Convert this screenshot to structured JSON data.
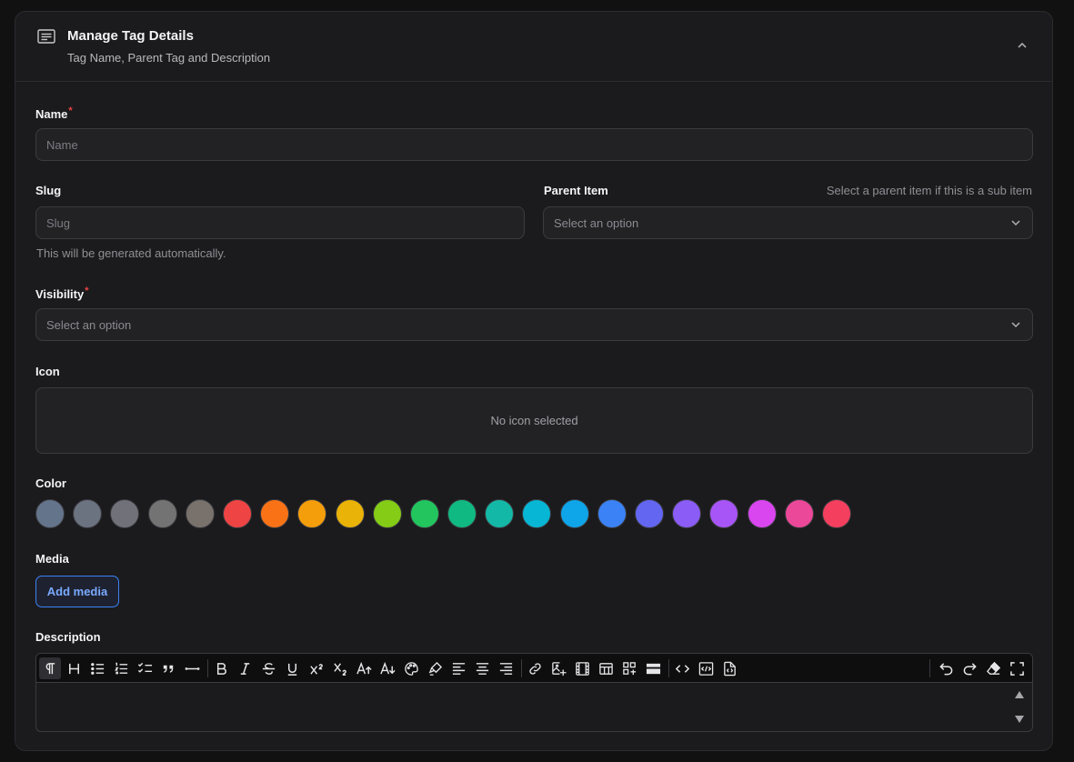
{
  "header": {
    "title": "Manage Tag Details",
    "subtitle": "Tag Name, Parent Tag and Description"
  },
  "form": {
    "name": {
      "label": "Name",
      "required_mark": "*",
      "placeholder": "Name"
    },
    "slug": {
      "label": "Slug",
      "placeholder": "Slug",
      "helper": "This will be generated automatically."
    },
    "parent": {
      "label": "Parent Item",
      "hint": "Select a parent item if this is a sub item",
      "value": "Select an option"
    },
    "visibility": {
      "label": "Visibility",
      "required_mark": "*",
      "value": "Select an option"
    },
    "icon": {
      "label": "Icon",
      "empty_text": "No icon selected"
    },
    "color": {
      "label": "Color",
      "swatches": [
        "#64748b",
        "#6b7280",
        "#71717a",
        "#737373",
        "#78716c",
        "#ef4444",
        "#f97316",
        "#f59e0b",
        "#eab308",
        "#84cc16",
        "#22c55e",
        "#10b981",
        "#14b8a6",
        "#06b6d4",
        "#0ea5e9",
        "#3b82f6",
        "#6366f1",
        "#8b5cf6",
        "#a855f7",
        "#d946ef",
        "#ec4899",
        "#f43f5e"
      ]
    },
    "media": {
      "label": "Media",
      "button": "Add media"
    },
    "description": {
      "label": "Description",
      "toolbar": [
        "paragraph-icon",
        "heading-icon",
        "bullet-list-icon",
        "ordered-list-icon",
        "task-list-icon",
        "blockquote-icon",
        "horizontal-rule-icon",
        "bold-icon",
        "italic-icon",
        "strikethrough-icon",
        "underline-icon",
        "superscript-icon",
        "subscript-icon",
        "font-size-increase-icon",
        "font-size-decrease-icon",
        "text-color-icon",
        "highlight-icon",
        "align-left-icon",
        "align-center-icon",
        "align-right-icon",
        "link-icon",
        "insert-image-icon",
        "insert-video-icon",
        "insert-table-icon",
        "insert-grid-icon",
        "insert-block-icon",
        "code-icon",
        "code-block-icon",
        "html-source-icon",
        "undo-icon",
        "redo-icon",
        "clear-format-icon",
        "fullscreen-icon"
      ]
    }
  },
  "colors": {
    "accent": "#3b82f6",
    "required": "#ef4444"
  }
}
